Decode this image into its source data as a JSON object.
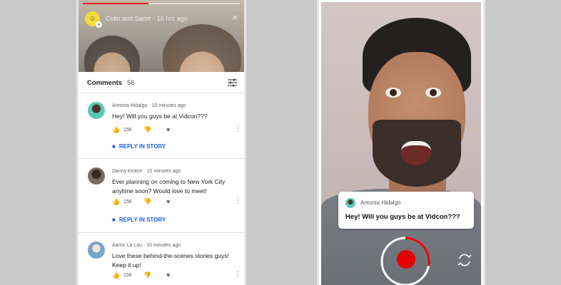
{
  "story": {
    "title": "Colin and Samir",
    "time": "16 hrs ago",
    "progress": 0.42,
    "avatar_icon": "emoji-avatar-icon",
    "close_icon": "×"
  },
  "comments_header": {
    "title": "Comments",
    "count": "56",
    "filter_icon": "filter-icon"
  },
  "comments": [
    {
      "author": "Antonia Hidalgo",
      "time": "10 minutes ago",
      "text": "Hey! Will you guys be at Vidcon???",
      "likes": "156",
      "reply_label": "REPLY IN STORY"
    },
    {
      "author": "Danny Keane",
      "time": "10 minutes ago",
      "text": "Ever planning on coming to New York City anytime soon? Would love to meet!",
      "likes": "156",
      "reply_label": "REPLY IN STORY"
    },
    {
      "author": "Aaron La Lau",
      "time": "10 minutes ago",
      "text": "Love these behind-the-scenes stories guys! Keep it up!",
      "likes": "156"
    }
  ],
  "quote_card": {
    "author": "Antonia Hidalgo",
    "text": "Hey! Will you guys be at Vidcon???"
  },
  "recording": {
    "progress": 0.28,
    "accent_color": "#e60000"
  },
  "colors": {
    "link_blue": "#1a61d6",
    "record_red": "#e60000"
  }
}
